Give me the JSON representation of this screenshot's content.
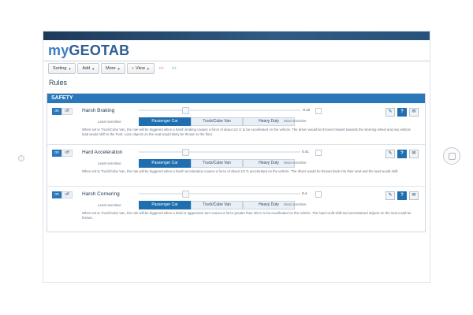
{
  "logo": {
    "my": "my",
    "geotab": "GEOTAB"
  },
  "toolbar": {
    "sorting": "Sorting",
    "add": "Add",
    "more": "More",
    "view": "View"
  },
  "page": {
    "title": "Rules"
  },
  "section": {
    "title": "SAFETY"
  },
  "common": {
    "on": "on",
    "off": "off",
    "least_sensitive": "Least sensitive",
    "most_sensitive": "Most sensitive",
    "options": [
      "Passenger Car",
      "Truck/Cube Van",
      "Heavy Duty"
    ],
    "help": "?"
  },
  "rules": [
    {
      "name": "Harsh Braking",
      "value": "-0.32",
      "level": 0.0,
      "selected_option": "Passenger Car",
      "description": "When set to Truck/Cube Van, the rule will be triggered when a harsh braking causes a force of about 1/2 G to be excelleated on the vehicle. The driver would be thrown forward towards the steering wheel and any vehicle load would shift to the front. Lose objects on the seat would likely be thrown to the floor."
    },
    {
      "name": "Hard Acceleration",
      "value": "0.41",
      "level": 0.0,
      "selected_option": "Passenger Car",
      "description": "When set to Truck/Cube Van, the rule will be triggered when a harsh acceleration causes a force of about 1/2 G accelerated on the vehicle. The driver would be thrown back into their seat and the load would shift."
    },
    {
      "name": "Harsh Cornering",
      "value": "0.4",
      "level": 0.0,
      "selected_option": "Passenger Car",
      "description": "When set to Truck/Cube Van, the rule will be triggered when a hard or aggressive turn causes a force greater than 3/8 G to be excelleated on the vehicle. The load could shift and unrestrained objects on the seat could be thrown."
    }
  ],
  "colors": {
    "accent": "#2a77b9",
    "header_dark": "#1e3a5a"
  }
}
